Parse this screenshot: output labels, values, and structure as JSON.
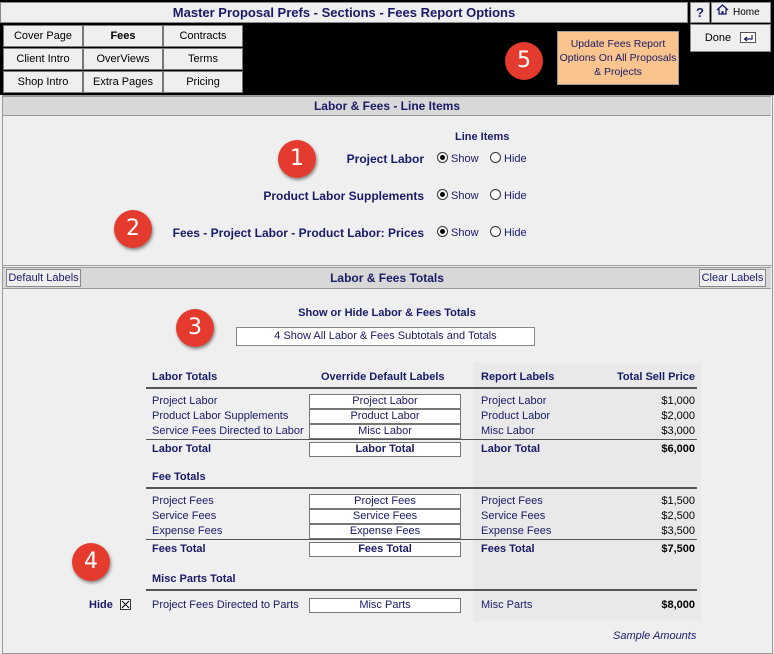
{
  "window": {
    "title": "Master Proposal Prefs - Sections - Fees Report Options",
    "help_label": "?",
    "home_label": "Home",
    "done_label": "Done"
  },
  "nav": {
    "items": [
      {
        "label": "Cover Page",
        "active": false
      },
      {
        "label": "Fees",
        "active": true
      },
      {
        "label": "Contracts",
        "active": false
      },
      {
        "label": "Client Intro",
        "active": false
      },
      {
        "label": "OverViews",
        "active": false
      },
      {
        "label": "Terms",
        "active": false
      },
      {
        "label": "Shop Intro",
        "active": false
      },
      {
        "label": "Extra Pages",
        "active": false
      },
      {
        "label": "Pricing",
        "active": false
      }
    ]
  },
  "update_button": {
    "label": "Update Fees Report Options On All Proposals & Projects"
  },
  "badges": [
    "1",
    "2",
    "3",
    "4",
    "5"
  ],
  "line_items": {
    "section_title": "Labor & Fees -  Line Items",
    "column_title": "Line Items",
    "rows": [
      {
        "label": "Project Labor",
        "show": "Show",
        "hide": "Hide",
        "selected": "show"
      },
      {
        "label": "Product Labor Supplements",
        "show": "Show",
        "hide": "Hide",
        "selected": "show"
      },
      {
        "label": "Fees - Project Labor - Product Labor:  Prices",
        "show": "Show",
        "hide": "Hide",
        "selected": "show"
      }
    ]
  },
  "totals": {
    "section_title": "Labor & Fees Totals",
    "default_labels_btn": "Default Labels",
    "clear_labels_btn": "Clear Labels",
    "show_hide_title": "Show or Hide Labor & Fees Totals",
    "selected_option": "4 Show All Labor & Fees Subtotals and Totals",
    "headers": {
      "labor_totals": "Labor Totals",
      "override": "Override Default Labels",
      "report_labels": "Report Labels",
      "total_sell": "Total Sell Price"
    },
    "labor_rows": [
      {
        "name": "Project Labor",
        "override": "Project Labor",
        "report": "Project Labor",
        "amount": "$1,000"
      },
      {
        "name": "Product Labor Supplements",
        "override": "Product Labor",
        "report": "Product Labor",
        "amount": "$2,000"
      },
      {
        "name": "Service Fees Directed to Labor",
        "override": "Misc Labor",
        "report": "Misc Labor",
        "amount": "$3,000"
      }
    ],
    "labor_total": {
      "name": "Labor Total",
      "override": "Labor Total",
      "report": "Labor Total",
      "amount": "$6,000"
    },
    "fee_totals_title": "Fee Totals",
    "fee_rows": [
      {
        "name": "Project Fees",
        "override": "Project Fees",
        "report": "Project Fees",
        "amount": "$1,500"
      },
      {
        "name": "Service Fees",
        "override": "Service Fees",
        "report": "Service Fees",
        "amount": "$2,500"
      },
      {
        "name": "Expense Fees",
        "override": "Expense Fees",
        "report": "Expense Fees",
        "amount": "$3,500"
      }
    ],
    "fees_total": {
      "name": "Fees Total",
      "override": "Fees Total",
      "report": "Fees Total",
      "amount": "$7,500"
    },
    "misc_parts_title": "Misc Parts Total",
    "hide_label": "Hide",
    "hide_checked": true,
    "misc_row": {
      "name": "Project Fees Directed to Parts",
      "override": "Misc Parts",
      "report": "Misc Parts",
      "amount": "$8,000"
    },
    "sample_note": "Sample Amounts"
  },
  "colors": {
    "accent_orange": "#f9c48d",
    "badge_red": "#e53b2f",
    "text_navy": "#1a1a66"
  }
}
